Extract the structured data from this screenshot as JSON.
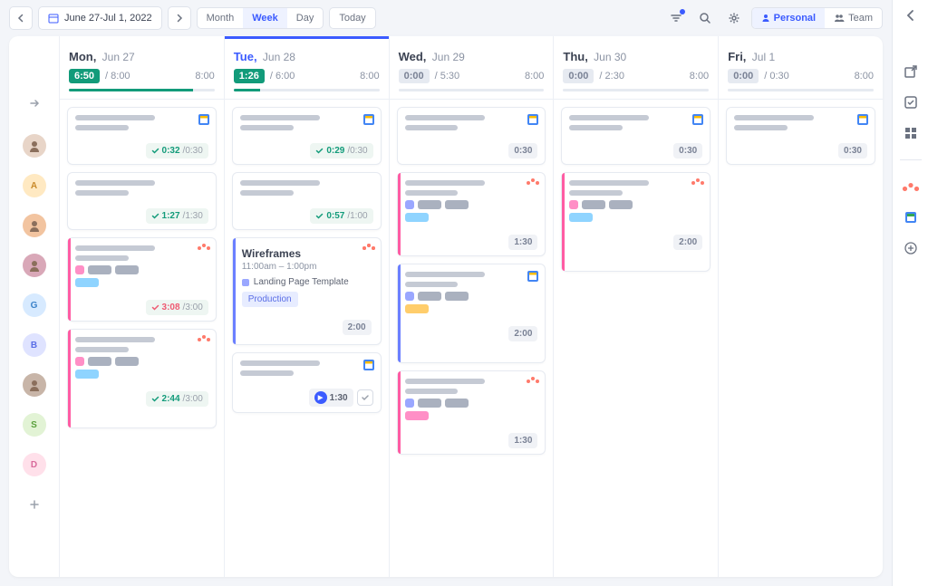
{
  "toolbar": {
    "date_range": "June 27-Jul 1, 2022",
    "views": [
      "Month",
      "Week",
      "Day"
    ],
    "active_view": "Week",
    "today_label": "Today",
    "scope": {
      "personal": "Personal",
      "team": "Team",
      "active": "Personal"
    }
  },
  "members": [
    {
      "type": "img",
      "bg": "#e8d5c8",
      "active": true
    },
    {
      "type": "letter",
      "letter": "A",
      "bg": "#ffe9c2",
      "fg": "#c98a2a"
    },
    {
      "type": "img",
      "bg": "#f2c4a0"
    },
    {
      "type": "img",
      "bg": "#d9a8b8"
    },
    {
      "type": "letter",
      "letter": "G",
      "bg": "#d7eaff",
      "fg": "#3b82c9"
    },
    {
      "type": "letter",
      "letter": "B",
      "bg": "#dfe3ff",
      "fg": "#5a6ee6"
    },
    {
      "type": "img",
      "bg": "#c8b5a8"
    },
    {
      "type": "letter",
      "letter": "S",
      "bg": "#e2f3d5",
      "fg": "#5aa03c"
    },
    {
      "type": "letter",
      "letter": "D",
      "bg": "#ffe0ea",
      "fg": "#d96a9b"
    }
  ],
  "days": [
    {
      "dow": "Mon,",
      "date": "Jun 27",
      "active": false,
      "tracked": "6:50",
      "planned": "8:00",
      "cap": "8:00",
      "pct": 85,
      "badge": "green",
      "cards": [
        {
          "type": "gcal",
          "foot": "track",
          "tracked": "0:32",
          "planned": "0:30"
        },
        {
          "type": "plain",
          "foot": "track",
          "tracked": "1:27",
          "planned": "1:30"
        },
        {
          "type": "asana",
          "stripe": "pink",
          "tags": [
            [
              "sq",
              "#ff8fc6"
            ],
            [
              "",
              "#aab1bf"
            ],
            [
              "",
              "#aab1bf"
            ]
          ],
          "sub": "#8fd4ff",
          "foot": "track",
          "tracked": "3:08",
          "planned": "3:00",
          "tracked_color": "#ef5a72"
        },
        {
          "type": "asana",
          "stripe": "pink",
          "tags": [
            [
              "sq",
              "#ff8fc6"
            ],
            [
              "",
              "#aab1bf"
            ],
            [
              "",
              "#aab1bf"
            ]
          ],
          "sub": "#8fd4ff",
          "foot": "track",
          "tracked": "2:44",
          "planned": "3:00",
          "tall": true
        }
      ]
    },
    {
      "dow": "Tue,",
      "date": "Jun 28",
      "active": true,
      "tracked": "1:26",
      "planned": "6:00",
      "cap": "8:00",
      "pct": 18,
      "badge": "green",
      "cards": [
        {
          "type": "gcal",
          "foot": "track",
          "tracked": "0:29",
          "planned": "0:30"
        },
        {
          "type": "plain",
          "foot": "track",
          "tracked": "0:57",
          "planned": "1:00"
        },
        {
          "type": "wire",
          "title": "Wireframes",
          "time": "11:00am – 1:00pm",
          "meta": "Landing Page Template",
          "label": "Production",
          "asana_top": true,
          "foot": "neu",
          "planned": "2:00",
          "stripe": "blue"
        },
        {
          "type": "gcal",
          "foot": "play",
          "planned": "1:30"
        }
      ]
    },
    {
      "dow": "Wed,",
      "date": "Jun 29",
      "active": false,
      "tracked": "0:00",
      "planned": "5:30",
      "cap": "8:00",
      "pct": 0,
      "badge": "gray",
      "cards": [
        {
          "type": "gcal",
          "foot": "neu",
          "planned": "0:30"
        },
        {
          "type": "asana",
          "stripe": "pink",
          "tags": [
            [
              "sq",
              "#9aa7ff"
            ],
            [
              "",
              "#aab1bf"
            ],
            [
              "",
              "#aab1bf"
            ]
          ],
          "sub": "#8fd4ff",
          "foot": "neu",
          "planned": "1:30"
        },
        {
          "type": "gcal",
          "stripe": "blue",
          "tags": [
            [
              "sq",
              "#9aa7ff"
            ],
            [
              "",
              "#aab1bf"
            ],
            [
              "",
              "#aab1bf"
            ]
          ],
          "sub": "#ffcd6b",
          "foot": "neu",
          "planned": "2:00",
          "tall": true
        },
        {
          "type": "asana",
          "stripe": "pink",
          "tags": [
            [
              "sq",
              "#9aa7ff"
            ],
            [
              "",
              "#aab1bf"
            ],
            [
              "",
              "#aab1bf"
            ]
          ],
          "sub": "#ff8fc6",
          "foot": "neu",
          "planned": "1:30"
        }
      ]
    },
    {
      "dow": "Thu,",
      "date": "Jun 30",
      "active": false,
      "tracked": "0:00",
      "planned": "2:30",
      "cap": "8:00",
      "pct": 0,
      "badge": "gray",
      "cards": [
        {
          "type": "gcal",
          "foot": "neu",
          "planned": "0:30"
        },
        {
          "type": "asana",
          "stripe": "pink",
          "tags": [
            [
              "sq",
              "#ff8fc6"
            ],
            [
              "",
              "#aab1bf"
            ],
            [
              "",
              "#aab1bf"
            ]
          ],
          "sub": "#8fd4ff",
          "foot": "neu",
          "planned": "2:00",
          "tall": true
        }
      ]
    },
    {
      "dow": "Fri,",
      "date": "Jul 1",
      "active": false,
      "tracked": "0:00",
      "planned": "0:30",
      "cap": "8:00",
      "pct": 0,
      "badge": "gray",
      "cards": [
        {
          "type": "gcal",
          "foot": "neu",
          "planned": "0:30"
        }
      ]
    }
  ]
}
